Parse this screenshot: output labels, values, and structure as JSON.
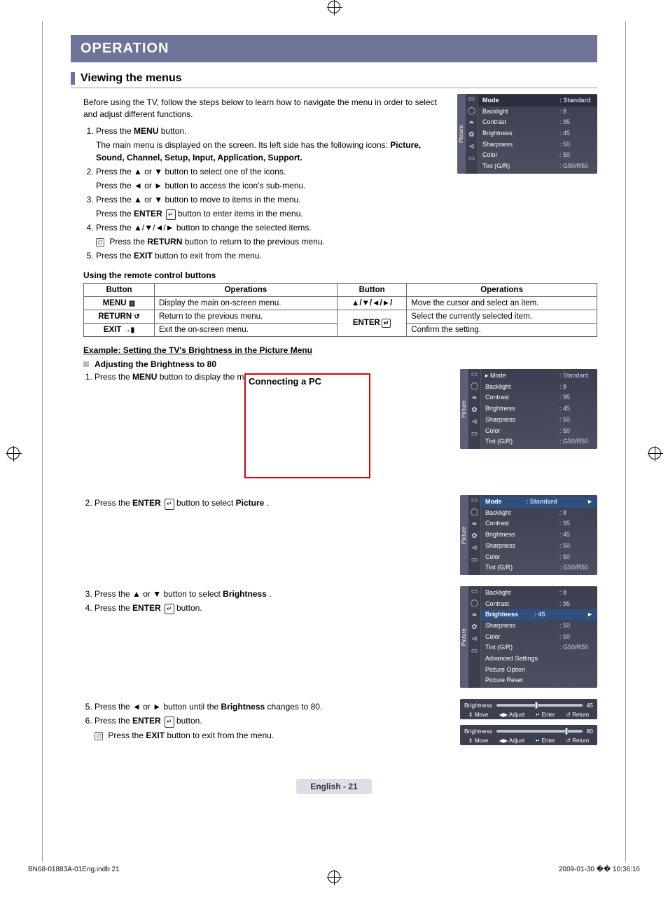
{
  "header": {
    "title": "OPERATION"
  },
  "section1": {
    "title": "Viewing the menus",
    "intro": "Before using the TV, follow the steps below to learn how to navigate the menu in order to select and adjust different functions.",
    "steps": [
      {
        "lead": "Press the ",
        "bold": "MENU",
        "tail": " button.",
        "sub1": "The main menu is displayed on the screen. Its left side has the following icons: ",
        "sub1_bold": "Picture, Sound, Channel, Setup, Input, Application, Support."
      },
      {
        "lead": "Press the ▲ or ▼ button to select one of the icons.",
        "sub1": "Press the ◄ or ► button to access the icon's sub-menu."
      },
      {
        "lead": "Press the ▲ or ▼ button to move to items in the menu.",
        "sub1a": "Press the ",
        "sub1b": "ENTER",
        "sub1c": " button to enter items in the menu."
      },
      {
        "lead": "Press the ▲/▼/◄/► button to change the selected items.",
        "note_a": "Press the ",
        "note_b": "RETURN",
        "note_c": " button to return to the previous menu."
      },
      {
        "lead_a": "Press the ",
        "lead_b": "EXIT",
        "lead_c": " button to exit from the menu."
      }
    ],
    "remote_heading": "Using the remote control buttons",
    "table": {
      "h1": "Button",
      "h2": "Operations",
      "h3": "Button",
      "h4": "Operations",
      "r1c1_a": "MENU",
      "r1c1_icon": "▥",
      "r1c2": "Display the main on-screen menu.",
      "r1c3": "▲/▼/◄/►/",
      "r1c4": "Move the cursor and select an item.",
      "r2c1_a": "RETURN",
      "r2c1_icon": "↺",
      "r2c2": "Return to the previous menu.",
      "r2c3_a": "ENTER",
      "r2c4": "Select the currently selected item.",
      "r3c1_a": "EXIT",
      "r3c1_icon": "→▮",
      "r3c2": "Exit the on-screen menu.",
      "r3c4": "Confirm the setting."
    }
  },
  "example": {
    "title": "Example: Setting the TV's Brightness in the Picture Menu",
    "sub": "Adjusting the Brightness to 80",
    "s1_a": "Press the ",
    "s1_b": "MENU",
    "s1_c": " button to display the menu.",
    "redbox_title": "Connecting a PC",
    "s2_a": "Press the ",
    "s2_b": "ENTER",
    "s2_c": " button to select ",
    "s2_d": "Picture",
    "s2_e": ".",
    "s3": "Press the ▲ or ▼ button to select ",
    "s3_b": "Brightness",
    "s3_c": ".",
    "s4_a": "Press the ",
    "s4_b": "ENTER",
    "s4_c": " button.",
    "s5": "Press the ◄ or ► button until the ",
    "s5_b": "Brightness",
    "s5_c": " changes to 80.",
    "s6_a": "Press the ",
    "s6_b": "ENTER",
    "s6_c": " button.",
    "s6_note_a": "Press the ",
    "s6_note_b": "EXIT",
    "s6_note_c": " button to exit from the menu."
  },
  "osd_common": {
    "tab": "Picture",
    "rows": [
      {
        "k": "Mode",
        "v": ": Standard"
      },
      {
        "k": "Backlight",
        "v": ": 8"
      },
      {
        "k": "Contrast",
        "v": ": 95"
      },
      {
        "k": "Brightness",
        "v": ": 45"
      },
      {
        "k": "Sharpness",
        "v": ": 50"
      },
      {
        "k": "Color",
        "v": ": 50"
      },
      {
        "k": "Tint (G/R)",
        "v": ": G50/R50"
      }
    ]
  },
  "osd_scroll": {
    "tab": "Picture",
    "rows": [
      {
        "k": "Backlight",
        "v": ": 8"
      },
      {
        "k": "Contrast",
        "v": ": 95"
      },
      {
        "k": "Brightness",
        "v": ": 45",
        "hl": true
      },
      {
        "k": "Sharpness",
        "v": ": 50"
      },
      {
        "k": "Color",
        "v": ": 50"
      },
      {
        "k": "Tint (G/R)",
        "v": ": G50/R50"
      },
      {
        "k": "Advanced Settings",
        "v": ""
      },
      {
        "k": "Picture Option",
        "v": ""
      },
      {
        "k": "Picture Reset",
        "v": ""
      }
    ]
  },
  "slider": {
    "label": "Brightness",
    "val45": "45",
    "val80": "80",
    "nav_move": "Move",
    "nav_adjust": "Adjust",
    "nav_enter": "Enter",
    "nav_return": "Return"
  },
  "footer": {
    "page_label": "English - 21",
    "file": "BN68-01883A-01Eng.indb   21",
    "timestamp": "2009-01-30   �� 10:36:16"
  }
}
